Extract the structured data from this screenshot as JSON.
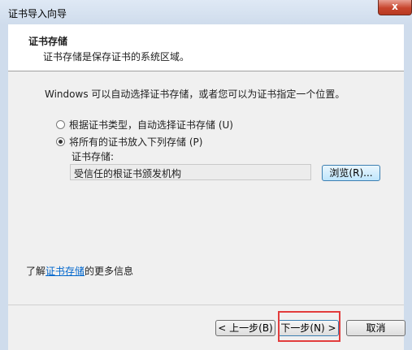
{
  "window": {
    "title": "证书导入向导",
    "close_label": "x"
  },
  "header": {
    "title": "证书存储",
    "description": "证书存储是保存证书的系统区域。"
  },
  "main": {
    "intro": "Windows 可以自动选择证书存储，或者您可以为证书指定一个位置。",
    "option_auto": {
      "label": "根据证书类型，自动选择证书存储 (U)",
      "selected": false
    },
    "option_manual": {
      "label": "将所有的证书放入下列存储 (P)",
      "selected": true
    },
    "store_label": "证书存储:",
    "store_value": "受信任的根证书颁发机构",
    "browse_label": "浏览(R)..."
  },
  "help": {
    "prefix": "了解",
    "link": "证书存储",
    "suffix": "的更多信息"
  },
  "footer": {
    "back_label": "< 上一步(B)",
    "next_label": "下一步(N) >",
    "cancel_label": "取消"
  },
  "colors": {
    "highlight": "#e23c3c",
    "link": "#0066cc"
  }
}
